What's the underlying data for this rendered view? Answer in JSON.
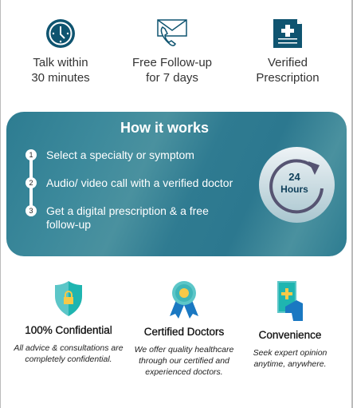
{
  "features": [
    {
      "icon": "clock-icon",
      "line1": "Talk within",
      "line2": "30 minutes"
    },
    {
      "icon": "envelope-phone-icon",
      "line1": "Free Follow-up",
      "line2": "for 7 days"
    },
    {
      "icon": "prescription-icon",
      "line1": "Verified",
      "line2": "Prescription"
    }
  ],
  "how_it_works": {
    "title": "How it works",
    "steps": [
      {
        "num": "1",
        "text": "Select a specialty or symptom"
      },
      {
        "num": "2",
        "text": "Audio/ video call with a verified doctor"
      },
      {
        "num": "3",
        "text": "Get a digital prescription & a free follow-up"
      }
    ],
    "timer": {
      "value": "24",
      "unit": "Hours"
    }
  },
  "benefits": [
    {
      "icon": "shield-lock-icon",
      "title": "100% Confidential",
      "desc": "All advice & consultations are completely confidential."
    },
    {
      "icon": "award-ribbon-icon",
      "title": "Certified Doctors",
      "desc": "We offer quality healthcare through our certified and experienced doctors."
    },
    {
      "icon": "phone-hand-icon",
      "title": "Convenience",
      "desc": "Seek expert opinion anytime, anywhere."
    }
  ],
  "colors": {
    "primary": "#0f5470",
    "card": "#2d7c91",
    "teal": "#1fb5b0",
    "yellow": "#f7c948",
    "blue": "#1a78c2"
  }
}
